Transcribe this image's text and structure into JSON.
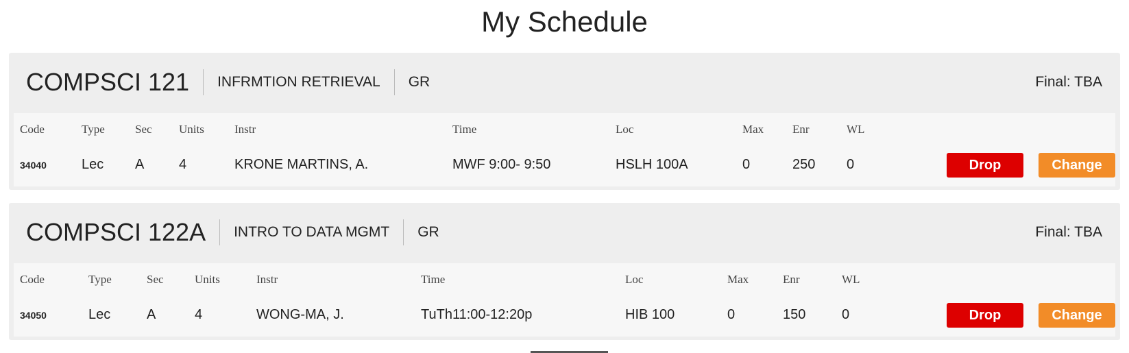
{
  "page": {
    "title": "My Schedule"
  },
  "columns": {
    "code": "Code",
    "type": "Type",
    "sec": "Sec",
    "units": "Units",
    "instr": "Instr",
    "time": "Time",
    "loc": "Loc",
    "max": "Max",
    "enr": "Enr",
    "wl": "WL"
  },
  "buttons": {
    "drop": "Drop",
    "change": "Change"
  },
  "colors": {
    "drop": "#dd0000",
    "change": "#f28c28",
    "card_bg": "#eeeeee",
    "table_bg": "#f7f7f7"
  },
  "courses": [
    {
      "code": "COMPSCI 121",
      "name": "INFRMTION RETRIEVAL",
      "level": "GR",
      "final": "Final: TBA",
      "section": {
        "code": "34040",
        "type": "Lec",
        "sec": "A",
        "units": "4",
        "instr": "KRONE MARTINS, A.",
        "time": "MWF 9:00- 9:50",
        "loc": "HSLH 100A",
        "max": "0",
        "enr": "250",
        "wl": "0"
      }
    },
    {
      "code": "COMPSCI 122A",
      "name": "INTRO TO DATA MGMT",
      "level": "GR",
      "final": "Final: TBA",
      "section": {
        "code": "34050",
        "type": "Lec",
        "sec": "A",
        "units": "4",
        "instr": "WONG-MA, J.",
        "time": "TuTh11:00-12:20p",
        "loc": "HIB 100",
        "max": "0",
        "enr": "150",
        "wl": "0"
      }
    }
  ]
}
